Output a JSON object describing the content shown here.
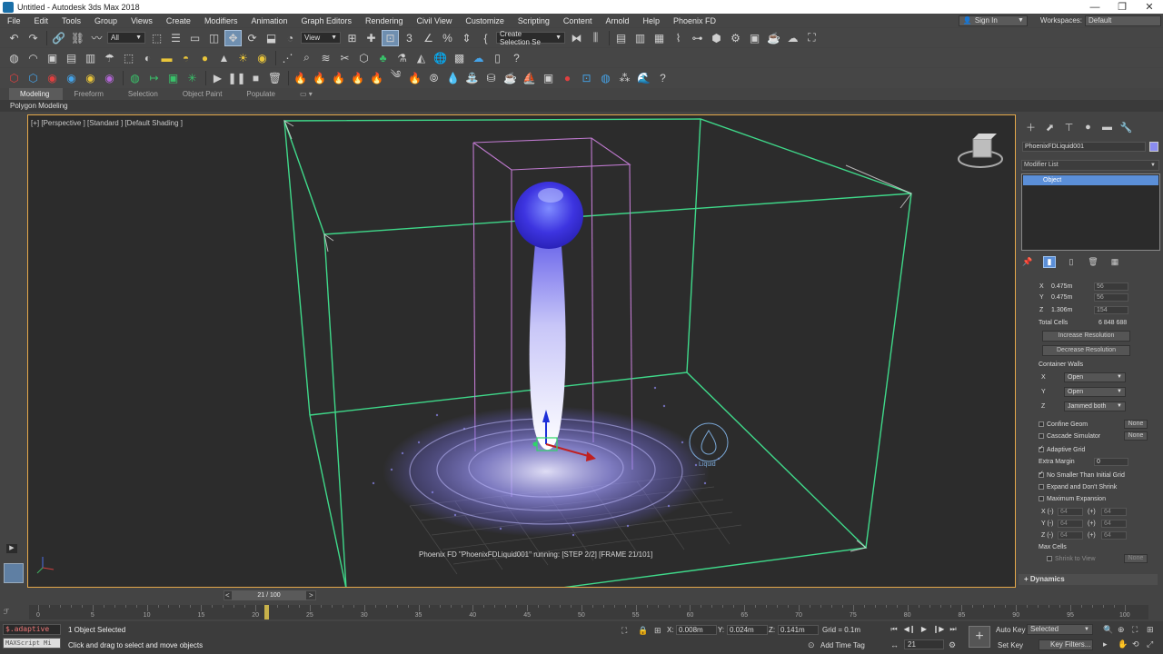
{
  "window": {
    "title": "Untitled - Autodesk 3ds Max 2018",
    "controls": [
      "—",
      "❐",
      "✕"
    ]
  },
  "menu": {
    "items": [
      "File",
      "Edit",
      "Tools",
      "Group",
      "Views",
      "Create",
      "Modifiers",
      "Animation",
      "Graph Editors",
      "Rendering",
      "Civil View",
      "Customize",
      "Scripting",
      "Content",
      "Arnold",
      "Help",
      "Phoenix FD"
    ],
    "sign_in": "Sign In",
    "workspaces_label": "Workspaces:",
    "workspace_value": "Default"
  },
  "toolbar": {
    "selection_filter": "All",
    "ref_coord": "View",
    "named_selection": "Create Selection Se"
  },
  "ribbon": {
    "tabs": [
      "Modeling",
      "Freeform",
      "Selection",
      "Object Paint",
      "Populate"
    ],
    "active_tab": "Modeling",
    "panel_label": "Polygon Modeling"
  },
  "viewport": {
    "label": "[+] [Perspective ] [Standard ] [Default Shading ]",
    "status": "Phoenix FD \"PhoenixFDLiquid001\" running: [STEP 2/2] [FRAME 21/101]",
    "liquid_label": "Liquid",
    "colors": {
      "container": "#3fd98a",
      "source_box": "#c07ad0",
      "liquid_light": "#ffffff",
      "liquid_dark": "#3a2fd9",
      "border": "#e5a84a"
    }
  },
  "command_panel": {
    "object_name": "PhoenixFDLiquid001",
    "object_color": "#8a8cf0",
    "modifier_list": "Modifier List",
    "stack_item": "Object",
    "params": {
      "x_label": "X",
      "x_val": "0.475m",
      "x_cells": "56",
      "y_label": "Y",
      "y_val": "0.475m",
      "y_cells": "56",
      "z_label": "Z",
      "z_val": "1.306m",
      "z_cells": "154",
      "total_cells_label": "Total Cells",
      "total_cells": "6 848 688",
      "increase_res": "Increase Resolution",
      "decrease_res": "Decrease Resolution",
      "container_walls": "Container Walls",
      "wall_x_label": "X",
      "wall_x": "Open",
      "wall_y_label": "Y",
      "wall_y": "Open",
      "wall_z_label": "Z",
      "wall_z": "Jammed both",
      "confine_geom": "Confine Geom",
      "cascade_sim": "Cascade Simulator",
      "none": "None",
      "adaptive_grid": "Adaptive Grid",
      "extra_margin": "Extra Margin",
      "extra_margin_val": "0",
      "no_smaller": "No Smaller Than Initial Grid",
      "expand_dont_shrink": "Expand and Don't Shrink",
      "max_expansion": "Maximum Expansion",
      "xm": "X (-)",
      "ym": "Y (-)",
      "zm": "Z (-)",
      "plus": "(+)",
      "exp_val": "64",
      "max_cells": "Max Cells",
      "shrink_to_view": "Shrink to View"
    },
    "rollout": "Dynamics"
  },
  "timeline": {
    "frame_display": "21 / 100",
    "ticks": [
      0,
      5,
      10,
      15,
      20,
      25,
      30,
      35,
      40,
      45,
      50,
      55,
      60,
      65,
      70,
      75,
      80,
      85,
      90,
      95,
      100
    ],
    "current_frame": 21
  },
  "status": {
    "maxscript_line1": "$.adaptive",
    "maxscript_line2": "MAXScript Mi",
    "selection": "1 Object Selected",
    "prompt": "Click and drag to select and move objects",
    "x_label": "X:",
    "x_val": "0.008m",
    "y_label": "Y:",
    "y_val": "0.024m",
    "z_label": "Z:",
    "z_val": "0.141m",
    "grid": "Grid = 0.1m",
    "add_time_tag": "Add Time Tag",
    "auto_key": "Auto Key",
    "set_key": "Set Key",
    "selected_dd": "Selected",
    "key_filters": "Key Filters...",
    "frame": "21"
  }
}
